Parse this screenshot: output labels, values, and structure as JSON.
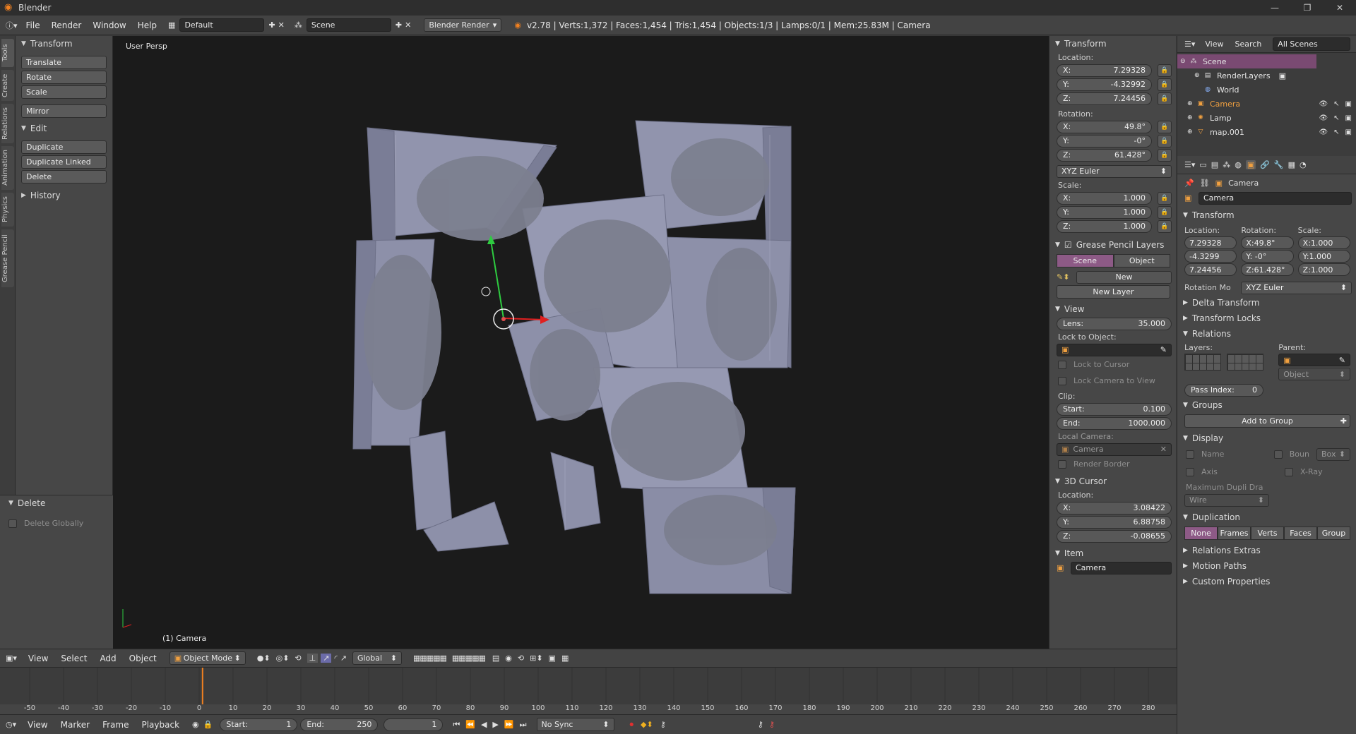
{
  "window": {
    "title": "Blender",
    "controls": [
      "—",
      "❐",
      "✕"
    ]
  },
  "infobar": {
    "menus": [
      "File",
      "Render",
      "Window",
      "Help"
    ],
    "layout": "Default",
    "scene": "Scene",
    "engine": "Blender Render",
    "stats": "v2.78 | Verts:1,372 | Faces:1,454 | Tris:1,454 | Objects:1/3 | Lamps:0/1 | Mem:25.83M | Camera"
  },
  "tooltabs": [
    "Tools",
    "Create",
    "Relations",
    "Animation",
    "Physics",
    "Grease Pencil"
  ],
  "toolshelf": {
    "transform_title": "Transform",
    "transform_buttons": [
      "Translate",
      "Rotate",
      "Scale"
    ],
    "mirror": "Mirror",
    "edit_title": "Edit",
    "edit_buttons": [
      "Duplicate",
      "Duplicate Linked",
      "Delete"
    ],
    "history_title": "History",
    "operator_title": "Delete",
    "operator_option": "Delete Globally"
  },
  "viewport": {
    "view_label": "User Persp",
    "active_object": "(1) Camera"
  },
  "npanel": {
    "transform_title": "Transform",
    "location_label": "Location:",
    "location": [
      "7.29328",
      "-4.32992",
      "7.24456"
    ],
    "rotation_label": "Rotation:",
    "rotation": [
      "49.8°",
      "-0°",
      "61.428°"
    ],
    "rotation_mode": "XYZ Euler",
    "scale_label": "Scale:",
    "scale": [
      "1.000",
      "1.000",
      "1.000"
    ],
    "axes": [
      "X:",
      "Y:",
      "Z:"
    ],
    "grease_title": "Grease Pencil Layers",
    "grease_tabs": [
      "Scene",
      "Object"
    ],
    "grease_new": "New",
    "grease_new_layer": "New Layer",
    "view_title": "View",
    "lens_label": "Lens:",
    "lens": "35.000",
    "lock_to_object": "Lock to Object:",
    "lock_to_cursor": "Lock to Cursor",
    "lock_camera": "Lock Camera to View",
    "clip_label": "Clip:",
    "clip_start_label": "Start:",
    "clip_start": "0.100",
    "clip_end_label": "End:",
    "clip_end": "1000.000",
    "local_camera_label": "Local Camera:",
    "local_camera": "Camera",
    "render_border": "Render Border",
    "cursor_title": "3D Cursor",
    "cursor_location_label": "Location:",
    "cursor": [
      "3.08422",
      "6.88758",
      "-0.08655"
    ],
    "item_title": "Item",
    "item_name": "Camera"
  },
  "outliner": {
    "menus": [
      "View",
      "Search"
    ],
    "filter": "All Scenes",
    "rows": [
      {
        "label": "Scene",
        "indent": 0
      },
      {
        "label": "RenderLayers",
        "indent": 2
      },
      {
        "label": "World",
        "indent": 2
      },
      {
        "label": "Camera",
        "indent": 1
      },
      {
        "label": "Lamp",
        "indent": 1
      },
      {
        "label": "map.001",
        "indent": 1
      }
    ]
  },
  "props": {
    "context": "Camera",
    "object_name": "Camera",
    "transform_title": "Transform",
    "col_labels": [
      "Location:",
      "Rotation:",
      "Scale:"
    ],
    "loc": [
      "7.29328",
      "-4.3299",
      "7.24456"
    ],
    "rot": [
      "X:49.8°",
      "Y: -0°",
      "Z:61.428°"
    ],
    "scl": [
      "X:1.000",
      "Y:1.000",
      "Z:1.000"
    ],
    "rotation_mode_label": "Rotation Mo",
    "rotation_mode": "XYZ Euler",
    "delta": "Delta Transform",
    "locks": "Transform Locks",
    "relations": "Relations",
    "layers_label": "Layers:",
    "parent_label": "Parent:",
    "parent_type": "Object",
    "pass_index_label": "Pass Index:",
    "pass_index": "0",
    "groups": "Groups",
    "add_to_group": "Add to Group",
    "display": "Display",
    "name_opt": "Name",
    "bounds_opt": "Boun",
    "bounds_type": "Box",
    "axis_opt": "Axis",
    "xray_opt": "X-Ray",
    "max_dupli": "Maximum Dupli Dra",
    "max_dupli_val": "Wire",
    "duplication": "Duplication",
    "dup_tabs": [
      "None",
      "Frames",
      "Verts",
      "Faces",
      "Group"
    ],
    "rel_extras": "Relations Extras",
    "motion_paths": "Motion Paths",
    "custom_props": "Custom Properties"
  },
  "vphdr": {
    "menus": [
      "View",
      "Select",
      "Add",
      "Object"
    ],
    "mode": "Object Mode",
    "orientation": "Global"
  },
  "timeline": {
    "ticks": [
      "-50",
      "-40",
      "-30",
      "-20",
      "-10",
      "0",
      "10",
      "20",
      "30",
      "40",
      "50",
      "60",
      "70",
      "80",
      "90",
      "100",
      "110",
      "120",
      "130",
      "140",
      "150",
      "160",
      "170",
      "180",
      "190",
      "200",
      "210",
      "220",
      "230",
      "240",
      "250",
      "260",
      "270",
      "280"
    ],
    "current_frame": 1,
    "menus": [
      "View",
      "Marker",
      "Frame",
      "Playback"
    ],
    "start_label": "Start:",
    "start": "1",
    "end_label": "End:",
    "end": "250",
    "frame": "1",
    "sync": "No Sync"
  },
  "colors": {
    "accent": "#8d5a86",
    "orange": "#f08020",
    "mesh": "#8c8fa8"
  }
}
